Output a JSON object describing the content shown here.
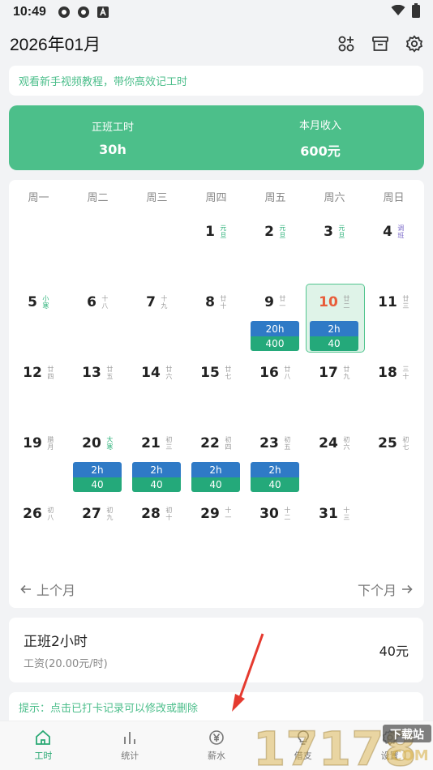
{
  "status_bar": {
    "time": "10:49"
  },
  "header": {
    "title": "2026年01月"
  },
  "tutorial_banner": "观看新手视频教程，带你高效记工时",
  "summary": {
    "work_label": "正班工时",
    "work_value": "30h",
    "income_label": "本月收入",
    "income_value": "600元"
  },
  "weekdays": [
    "周一",
    "周二",
    "周三",
    "周四",
    "周五",
    "周六",
    "周日"
  ],
  "calendar_rows": [
    [
      null,
      null,
      null,
      {
        "day": "1",
        "lunar": "元旦",
        "lunar_color": "green"
      },
      {
        "day": "2",
        "lunar": "元旦",
        "lunar_color": "green"
      },
      {
        "day": "3",
        "lunar": "元旦",
        "lunar_color": "green"
      },
      {
        "day": "4",
        "lunar": "调班",
        "lunar_color": "purple"
      }
    ],
    [
      {
        "day": "5",
        "lunar": "小寒",
        "lunar_color": "green"
      },
      {
        "day": "6",
        "lunar": "十八"
      },
      {
        "day": "7",
        "lunar": "十九"
      },
      {
        "day": "8",
        "lunar": "廿十"
      },
      {
        "day": "9",
        "lunar": "廿一",
        "hours": "20h",
        "money": "400"
      },
      {
        "day": "10",
        "lunar": "廿二",
        "today": true,
        "hours": "2h",
        "money": "40"
      },
      {
        "day": "11",
        "lunar": "廿三"
      }
    ],
    [
      {
        "day": "12",
        "lunar": "廿四"
      },
      {
        "day": "13",
        "lunar": "廿五"
      },
      {
        "day": "14",
        "lunar": "廿六"
      },
      {
        "day": "15",
        "lunar": "廿七"
      },
      {
        "day": "16",
        "lunar": "廿八"
      },
      {
        "day": "17",
        "lunar": "廿九"
      },
      {
        "day": "18",
        "lunar": "三十"
      }
    ],
    [
      {
        "day": "19",
        "lunar": "腊月"
      },
      {
        "day": "20",
        "lunar": "大寒",
        "lunar_color": "green",
        "hours": "2h",
        "money": "40"
      },
      {
        "day": "21",
        "lunar": "初三",
        "hours": "2h",
        "money": "40"
      },
      {
        "day": "22",
        "lunar": "初四",
        "hours": "2h",
        "money": "40"
      },
      {
        "day": "23",
        "lunar": "初五",
        "hours": "2h",
        "money": "40"
      },
      {
        "day": "24",
        "lunar": "初六"
      },
      {
        "day": "25",
        "lunar": "初七"
      }
    ],
    [
      {
        "day": "26",
        "lunar": "初八"
      },
      {
        "day": "27",
        "lunar": "初九"
      },
      {
        "day": "28",
        "lunar": "初十"
      },
      {
        "day": "29",
        "lunar": "十一"
      },
      {
        "day": "30",
        "lunar": "十二"
      },
      {
        "day": "31",
        "lunar": "十三"
      },
      null
    ]
  ],
  "month_nav": {
    "prev": "上个月",
    "next": "下个月"
  },
  "record": {
    "title": "正班2小时",
    "subtitle": "工资(20.00元/时)",
    "amount": "40元"
  },
  "tip": "提示：点击已打卡记录可以修改或删除",
  "tabs": [
    {
      "label": "工时",
      "icon": "home-icon",
      "active": true
    },
    {
      "label": "统计",
      "icon": "bar-chart-icon"
    },
    {
      "label": "薪水",
      "icon": "yuan-icon"
    },
    {
      "label": "借支",
      "icon": "lightbulb-icon"
    },
    {
      "label": "设置",
      "icon": "gear-icon"
    }
  ],
  "watermark": {
    "text": "17178",
    "badge": "下载站",
    "domain": ".COM"
  }
}
